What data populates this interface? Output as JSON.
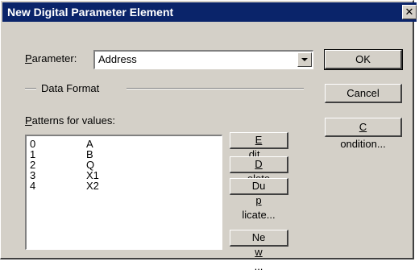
{
  "window": {
    "title": "New Digital Parameter Element",
    "close_symbol": "✕"
  },
  "parameter": {
    "label_accel": "P",
    "label_rest": "arameter:",
    "value": "Address"
  },
  "data_format": {
    "label": "Data Format"
  },
  "patterns": {
    "label_accel": "P",
    "label_rest": "atterns for values:",
    "items": [
      {
        "value": "0",
        "pattern": "A"
      },
      {
        "value": "1",
        "pattern": "B"
      },
      {
        "value": "2",
        "pattern": "Q"
      },
      {
        "value": "3",
        "pattern": "X1"
      },
      {
        "value": "4",
        "pattern": "X2"
      }
    ]
  },
  "buttons": {
    "ok": "OK",
    "cancel": "Cancel",
    "condition": {
      "accel": "C",
      "rest": "ondition..."
    },
    "edit": {
      "accel": "E",
      "rest": "dit..."
    },
    "delete": {
      "accel": "D",
      "rest": "elete"
    },
    "duplicate": {
      "pre": "Du",
      "accel": "p",
      "rest": "licate..."
    },
    "new": {
      "pre": "Ne",
      "accel": "w",
      "rest": "..."
    }
  }
}
